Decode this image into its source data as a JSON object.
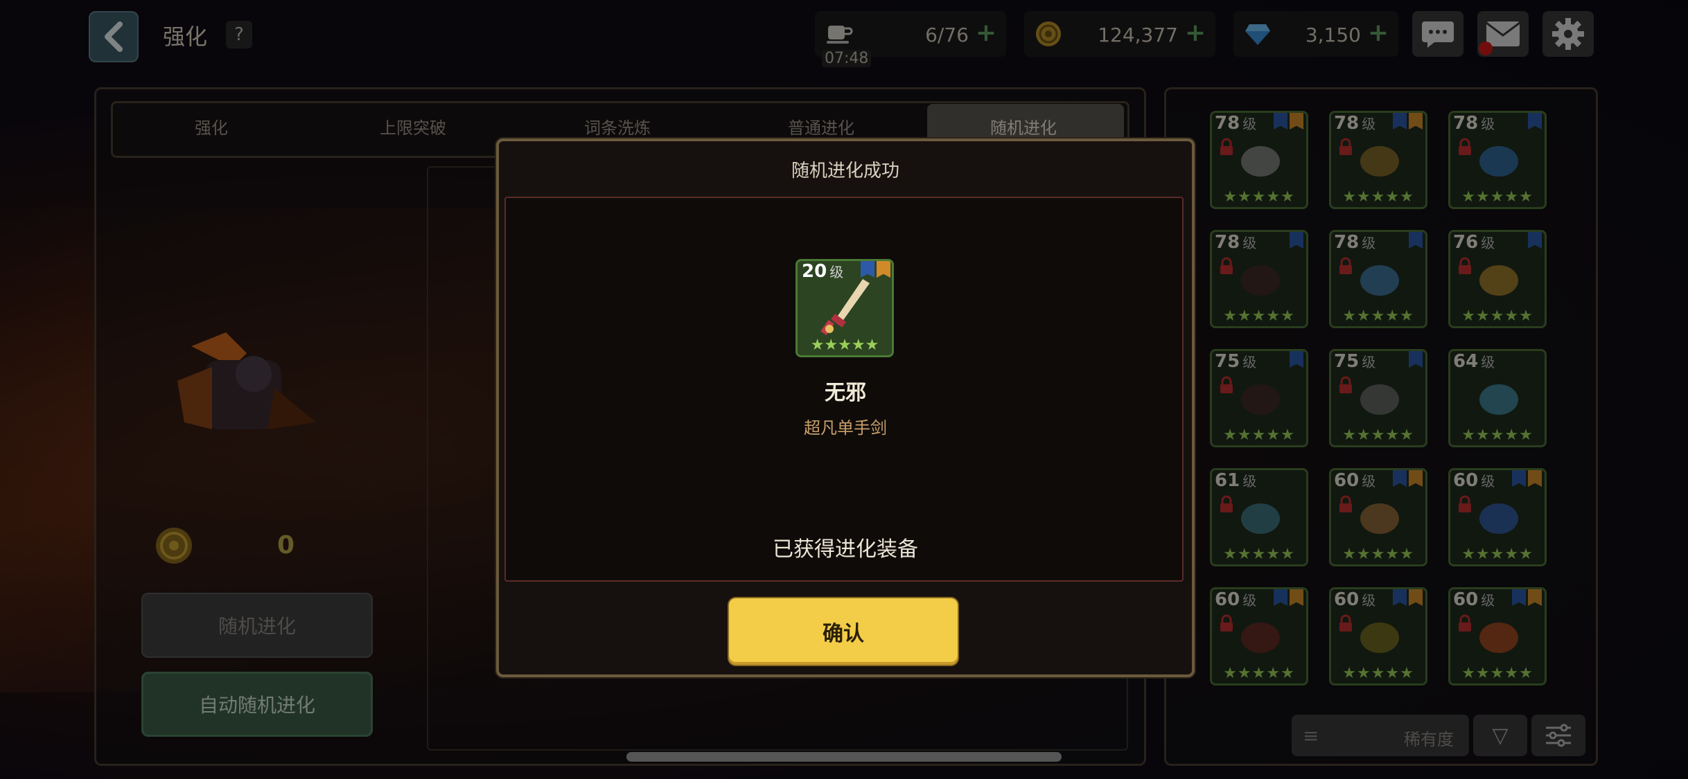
{
  "header": {
    "title": "强化",
    "help_label": "?",
    "stamina": {
      "value": "6/76",
      "timer": "07:48"
    },
    "gold": {
      "value": "124,377"
    },
    "gems": {
      "value": "3,150"
    },
    "plus_label": "+"
  },
  "tabs": [
    {
      "label": "强化"
    },
    {
      "label": "上限突破"
    },
    {
      "label": "词条洗炼"
    },
    {
      "label": "普通进化"
    },
    {
      "label": "随机进化"
    }
  ],
  "left": {
    "cost": "0",
    "random_button": "随机进化",
    "auto_button": "自动随机进化"
  },
  "inventory": {
    "level_suffix": "级",
    "stars": "★★★★★",
    "items": [
      {
        "level": "78",
        "name": "katana"
      },
      {
        "level": "78",
        "name": "heavy-gun"
      },
      {
        "level": "78",
        "name": "ring-amulet"
      },
      {
        "level": "78",
        "name": "demon-armor"
      },
      {
        "level": "78",
        "name": "blue-pendant"
      },
      {
        "level": "76",
        "name": "tiger-helm"
      },
      {
        "level": "75",
        "name": "demon-armor"
      },
      {
        "level": "75",
        "name": "chip"
      },
      {
        "level": "64",
        "name": "blue-beast"
      },
      {
        "level": "61",
        "name": "blue-rifle"
      },
      {
        "level": "60",
        "name": "harp"
      },
      {
        "level": "60",
        "name": "gold-staff"
      },
      {
        "level": "60",
        "name": "dark-spear"
      },
      {
        "level": "60",
        "name": "golden-mask"
      },
      {
        "level": "60",
        "name": "fire-orb"
      }
    ],
    "sort_label": "稀有度"
  },
  "modal": {
    "title": "随机进化成功",
    "item_level": "20",
    "level_suffix": "级",
    "item_stars": "★★★★★",
    "item_name": "无邪",
    "item_type": "超凡单手剑",
    "message": "已获得进化装备",
    "confirm": "确认"
  },
  "colors": {
    "confirm": "#f3cd48",
    "auto_button": "#3c5e48",
    "slot_border": "#4b6f35",
    "star": "#9bcf5a"
  }
}
